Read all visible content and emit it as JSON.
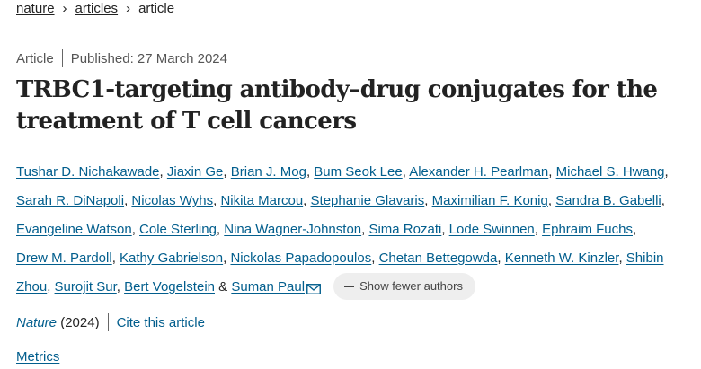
{
  "breadcrumb": {
    "items": [
      "nature",
      "articles"
    ],
    "current": "article",
    "separator": "›"
  },
  "meta": {
    "type": "Article",
    "published": "Published: 27 March 2024"
  },
  "title": {
    "line1": "TRBC1-targeting antibody–drug conjugates for the",
    "line2": "treatment of T cell cancers"
  },
  "authors": [
    "Tushar D. Nichakawade",
    "Jiaxin Ge",
    "Brian J. Mog",
    "Bum Seok Lee",
    "Alexander H. Pearlman",
    "Michael S. Hwang",
    "Sarah R. DiNapoli",
    "Nicolas Wyhs",
    "Nikita Marcou",
    "Stephanie Glavaris",
    "Maximilian F. Konig",
    "Sandra B. Gabelli",
    "Evangeline Watson",
    "Cole Sterling",
    "Nina Wagner-Johnston",
    "Sima Rozati",
    "Lode Swinnen",
    "Ephraim Fuchs",
    "Drew M. Pardoll",
    "Kathy Gabrielson",
    "Nickolas Papadopoulos",
    "Chetan Bettegowda",
    "Kenneth W. Kinzler",
    "Shibin Zhou",
    "Surojit Sur",
    "Bert Vogelstein",
    "Suman Paul"
  ],
  "authors_text": {
    "comma": ", ",
    "ampersand": " & ",
    "shibin_part1": "Shibin",
    "shibin_part2": "Zhou",
    "show_fewer": "Show fewer authors"
  },
  "journal": {
    "name": "Nature",
    "year": "(2024)",
    "cite": "Cite this article"
  },
  "metrics_label": "Metrics",
  "colors": {
    "link": "#025e8d",
    "text": "#222222",
    "muted": "#555555",
    "pill_bg": "#eeeeee"
  }
}
